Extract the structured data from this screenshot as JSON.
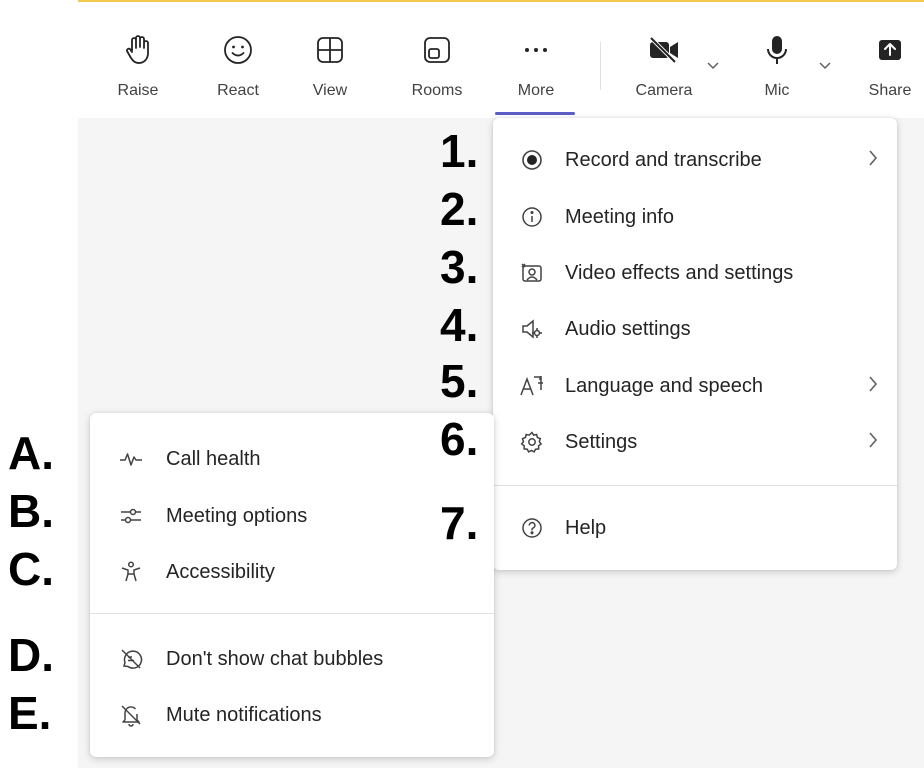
{
  "toolbar": {
    "raise": "Raise",
    "react": "React",
    "view": "View",
    "rooms": "Rooms",
    "more": "More",
    "camera": "Camera",
    "mic": "Mic",
    "share": "Share"
  },
  "more_menu": {
    "items": [
      {
        "label": "Record and transcribe",
        "icon": "record-icon",
        "submenu": true
      },
      {
        "label": "Meeting info",
        "icon": "info-icon",
        "submenu": false
      },
      {
        "label": "Video effects and settings",
        "icon": "video-effects-icon",
        "submenu": false
      },
      {
        "label": "Audio settings",
        "icon": "audio-settings-icon",
        "submenu": false
      },
      {
        "label": "Language and speech",
        "icon": "language-icon",
        "submenu": true
      },
      {
        "label": "Settings",
        "icon": "gear-icon",
        "submenu": true
      },
      {
        "label": "Help",
        "icon": "help-icon",
        "submenu": false
      }
    ]
  },
  "settings_submenu": {
    "items": [
      {
        "label": "Call health",
        "icon": "pulse-icon"
      },
      {
        "label": "Meeting options",
        "icon": "sliders-icon"
      },
      {
        "label": "Accessibility",
        "icon": "accessibility-icon"
      },
      {
        "label": "Don't show chat bubbles",
        "icon": "chat-off-icon"
      },
      {
        "label": "Mute notifications",
        "icon": "bell-off-icon"
      }
    ]
  },
  "markers": {
    "numbers": [
      "1.",
      "2.",
      "3.",
      "4.",
      "5.",
      "6.",
      "7."
    ],
    "letters": [
      "A.",
      "B.",
      "C.",
      "D.",
      "E."
    ]
  },
  "colors": {
    "accent": "#5b5fc7",
    "top_border": "#f2c94c",
    "stage_bg": "#f5f5f5"
  }
}
